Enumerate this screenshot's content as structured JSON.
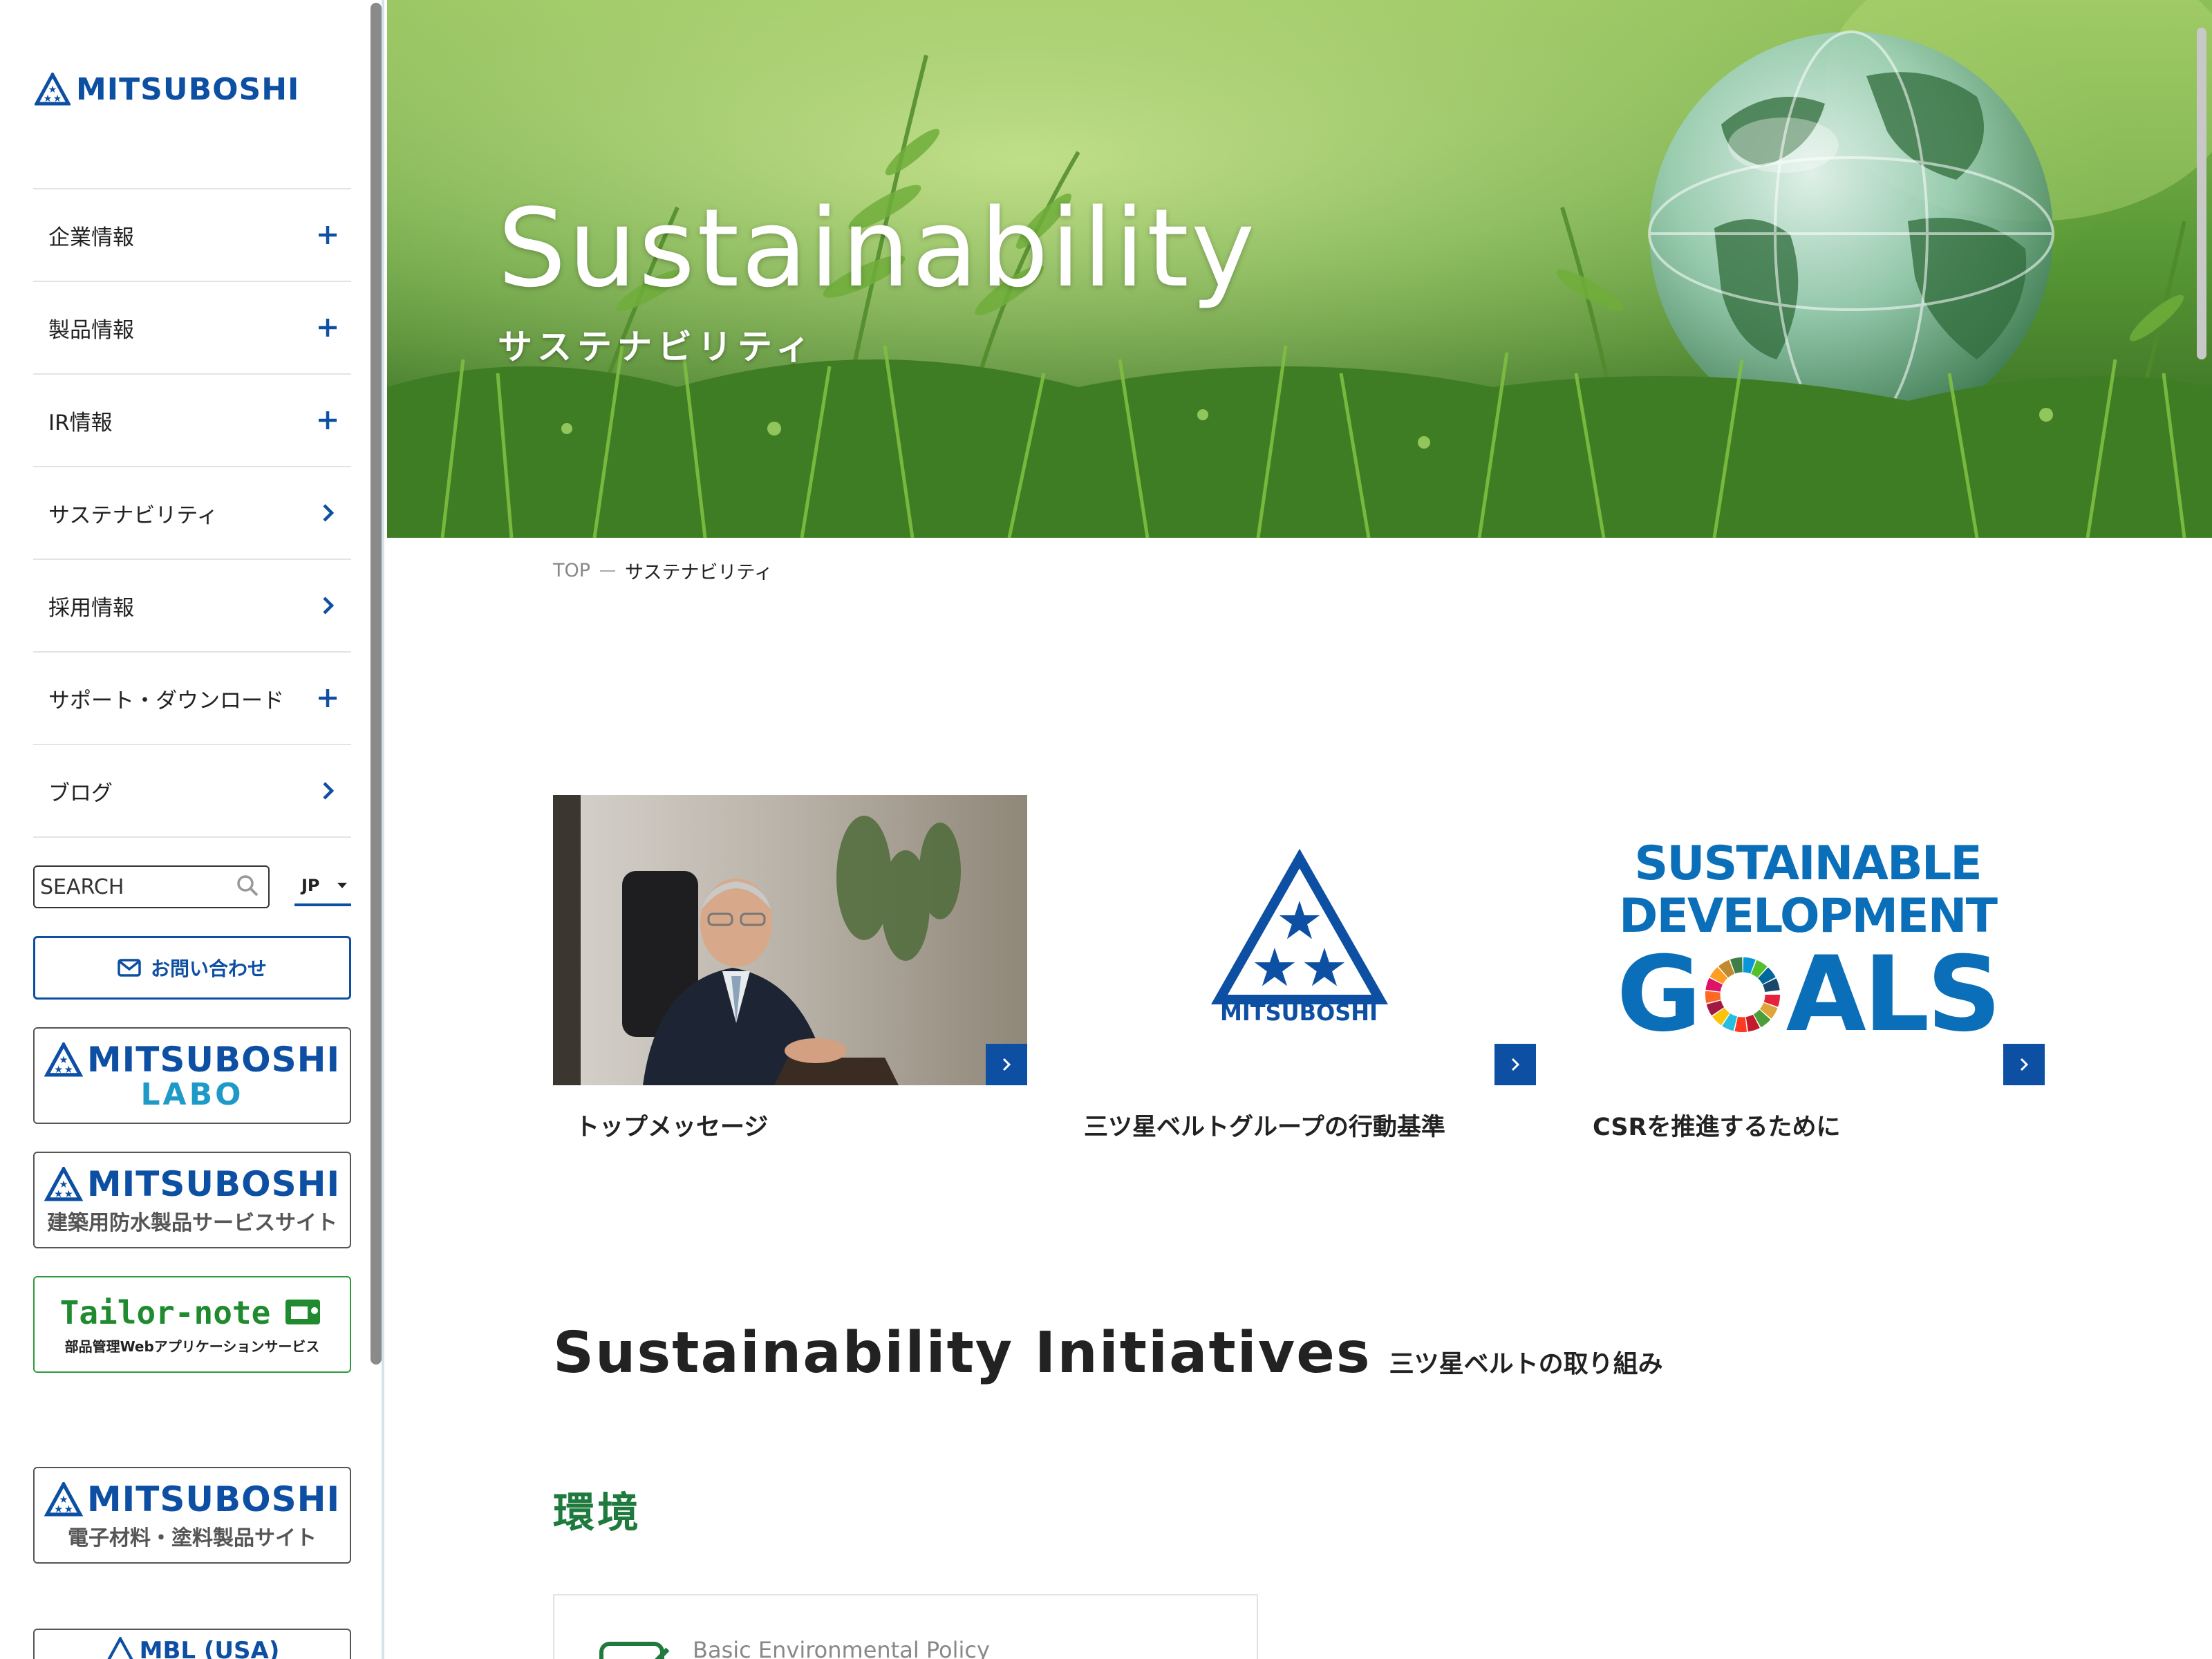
{
  "brand": {
    "name": "MITSUBOSHI",
    "color": "#0d4fa3"
  },
  "sidebar": {
    "nav": [
      {
        "label": "企業情報",
        "icon": "plus-icon"
      },
      {
        "label": "製品情報",
        "icon": "plus-icon"
      },
      {
        "label": "IR情報",
        "icon": "plus-icon"
      },
      {
        "label": "サステナビリティ",
        "icon": "chevron-right-icon"
      },
      {
        "label": "採用情報",
        "icon": "chevron-right-icon"
      },
      {
        "label": "サポート・ダウンロード",
        "icon": "plus-icon"
      },
      {
        "label": "ブログ",
        "icon": "chevron-right-icon"
      }
    ],
    "search": {
      "placeholder": "SEARCH"
    },
    "language": "JP",
    "contact_label": "お問い合わせ",
    "banners": [
      {
        "logo": "MITSUBOSHI",
        "sub": "LABO"
      },
      {
        "logo": "MITSUBOSHI",
        "sub": "建築用防水製品サービスサイト"
      },
      {
        "logo": "Tailor-note",
        "sub": "部品管理Webアプリケーションサービス"
      },
      {
        "logo": "MITSUBOSHI",
        "sub": "電子材料・塗料製品サイト"
      },
      {
        "logo": "MBL (USA)"
      }
    ]
  },
  "hero": {
    "title": "Sustainability",
    "subtitle": "サステナビリティ"
  },
  "breadcrumb": {
    "top": "TOP",
    "current": "サステナビリティ"
  },
  "cards": [
    {
      "label": "トップメッセージ"
    },
    {
      "label": "三ツ星ベルトグループの行動基準",
      "logo_text": "MITSUBOSHI"
    },
    {
      "label": "CSRを推進するために",
      "sdg_line1": "SUSTAINABLE",
      "sdg_line2": "DEVELOPMENT",
      "sdg_line3a": "G",
      "sdg_line3b": "ALS"
    }
  ],
  "section": {
    "title": "Sustainability Initiatives",
    "subtitle": "三ツ星ベルトの取り組み"
  },
  "environment": {
    "heading": "環境",
    "items": [
      {
        "label": "Basic Environmental Policy"
      }
    ]
  },
  "colors": {
    "accent": "#0d4fa3",
    "green_heading": "#1f7a3e",
    "labo": "#1e9ac8",
    "tailor": "#1f8a2e"
  }
}
